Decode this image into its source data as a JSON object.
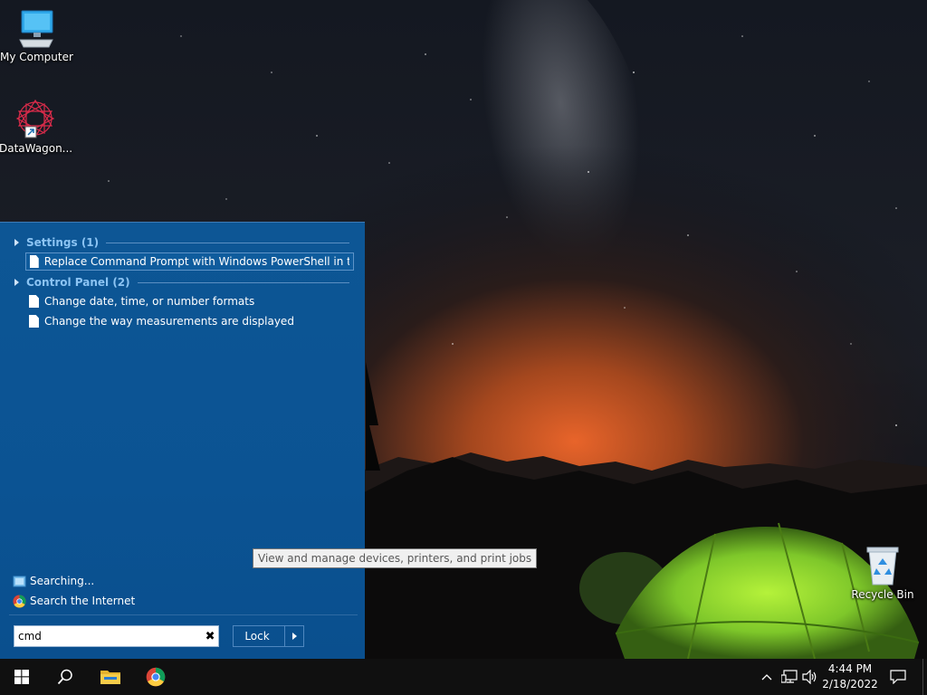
{
  "desktop": {
    "icons": [
      {
        "label": "My Computer",
        "icon": "computer-icon"
      },
      {
        "label": "DataWagon...",
        "icon": "datawagon-shortcut-icon"
      },
      {
        "label": "Recycle Bin",
        "icon": "recycle-bin-icon"
      }
    ],
    "tooltip": "View and manage devices, printers, and print jobs"
  },
  "start_menu": {
    "groups": [
      {
        "title": "Settings (1)",
        "items": [
          "Replace Command Prompt with Windows PowerShell in the W..."
        ]
      },
      {
        "title": "Control Panel (2)",
        "items": [
          "Change date, time, or number formats",
          "Change the way measurements are displayed"
        ]
      }
    ],
    "searching_label": "Searching...",
    "search_internet_label": "Search the Internet",
    "search_value": "cmd",
    "clear_label": "✖",
    "lock_label": "Lock"
  },
  "taskbar": {
    "pinned": [
      "windows-start-icon",
      "search-icon",
      "file-explorer-icon",
      "chrome-icon"
    ],
    "tray_icons": [
      "show-hidden-icons-chevron",
      "network-icon",
      "volume-icon",
      "action-center-icon"
    ],
    "time": "4:44 PM",
    "date": "2/18/2022"
  },
  "colors": {
    "start_menu_bg": "#0b5393",
    "group_title": "#8cc4f3",
    "taskbar_bg": "#101010"
  }
}
